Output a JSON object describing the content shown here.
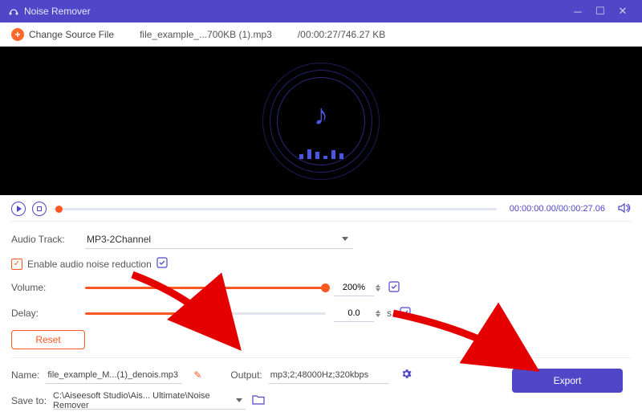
{
  "window": {
    "title": "Noise Remover"
  },
  "toolbar": {
    "change_source_label": "Change Source File",
    "filename": "file_example_...700KB (1).mp3",
    "meta": "/00:00:27/746.27 KB"
  },
  "playback": {
    "time_current": "00:00:00.00",
    "time_total": "/00:00:27.06"
  },
  "audio_track": {
    "label": "Audio Track:",
    "value": "MP3-2Channel"
  },
  "noise": {
    "checkbox_label": "Enable audio noise reduction"
  },
  "volume": {
    "label": "Volume:",
    "value": "200%",
    "fill_pct": 100
  },
  "delay": {
    "label": "Delay:",
    "value": "0.0",
    "unit": "s",
    "fill_pct": 40
  },
  "reset_label": "Reset",
  "name": {
    "label": "Name:",
    "value": "file_example_M...(1)_denois.mp3"
  },
  "output": {
    "label": "Output:",
    "value": "mp3;2;48000Hz;320kbps"
  },
  "save_to": {
    "label": "Save to:",
    "value": "C:\\Aiseesoft Studio\\Ais... Ultimate\\Noise Remover"
  },
  "export_label": "Export"
}
